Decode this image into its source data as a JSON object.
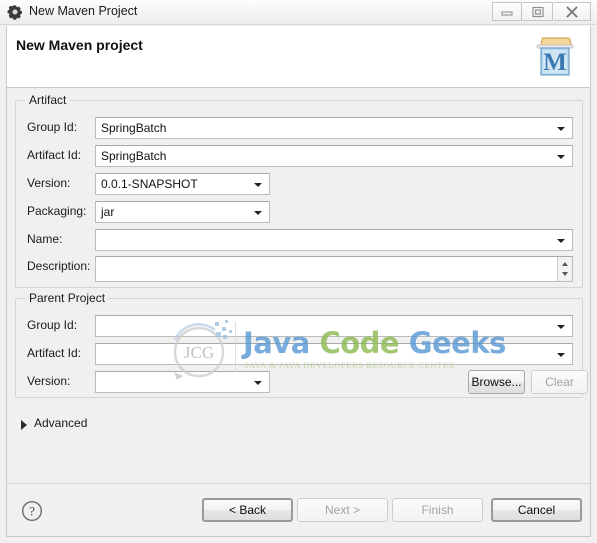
{
  "window": {
    "title": "New Maven Project",
    "icon": "gear-icon",
    "controls": {
      "minimize": "minimize-icon",
      "maximize": "restore-icon",
      "close": "close-icon"
    }
  },
  "header": {
    "title": "New Maven project",
    "icon": "maven-project-icon"
  },
  "artifact": {
    "legend": "Artifact",
    "fields": {
      "group_id": {
        "label": "Group Id:",
        "value": "SpringBatch",
        "placeholder": ""
      },
      "artifact_id": {
        "label": "Artifact Id:",
        "value": "SpringBatch",
        "placeholder": ""
      },
      "version": {
        "label": "Version:",
        "value": "0.0.1-SNAPSHOT",
        "placeholder": ""
      },
      "packaging": {
        "label": "Packaging:",
        "value": "jar",
        "placeholder": ""
      },
      "name": {
        "label": "Name:",
        "value": "",
        "placeholder": ""
      },
      "description": {
        "label": "Description:",
        "value": "",
        "placeholder": ""
      }
    }
  },
  "parent_project": {
    "legend": "Parent Project",
    "fields": {
      "group_id": {
        "label": "Group Id:",
        "value": "",
        "placeholder": ""
      },
      "artifact_id": {
        "label": "Artifact Id:",
        "value": "",
        "placeholder": ""
      },
      "version": {
        "label": "Version:",
        "value": "",
        "placeholder": ""
      }
    },
    "buttons": {
      "browse": {
        "label": "Browse...",
        "enabled": true
      },
      "clear": {
        "label": "Clear",
        "enabled": false
      }
    }
  },
  "advanced": {
    "label": "Advanced",
    "expanded": false,
    "icon": "chevron-right-icon"
  },
  "footer": {
    "help_icon": "help-icon",
    "buttons": {
      "back": {
        "label": "< Back",
        "enabled": true
      },
      "next": {
        "label": "Next >",
        "enabled": false
      },
      "finish": {
        "label": "Finish",
        "enabled": false
      },
      "cancel": {
        "label": "Cancel",
        "enabled": true
      }
    }
  },
  "watermark": {
    "monogram": "JCG",
    "word1": "Java",
    "word2": "Code",
    "word3": "Geeks",
    "subtitle": "JAVA & JAVA DEVELOPERS RESOURCE CENTER",
    "colors": {
      "blue": "#5b9bd5",
      "green": "#8fba54",
      "grey": "#c8c8c8"
    }
  }
}
